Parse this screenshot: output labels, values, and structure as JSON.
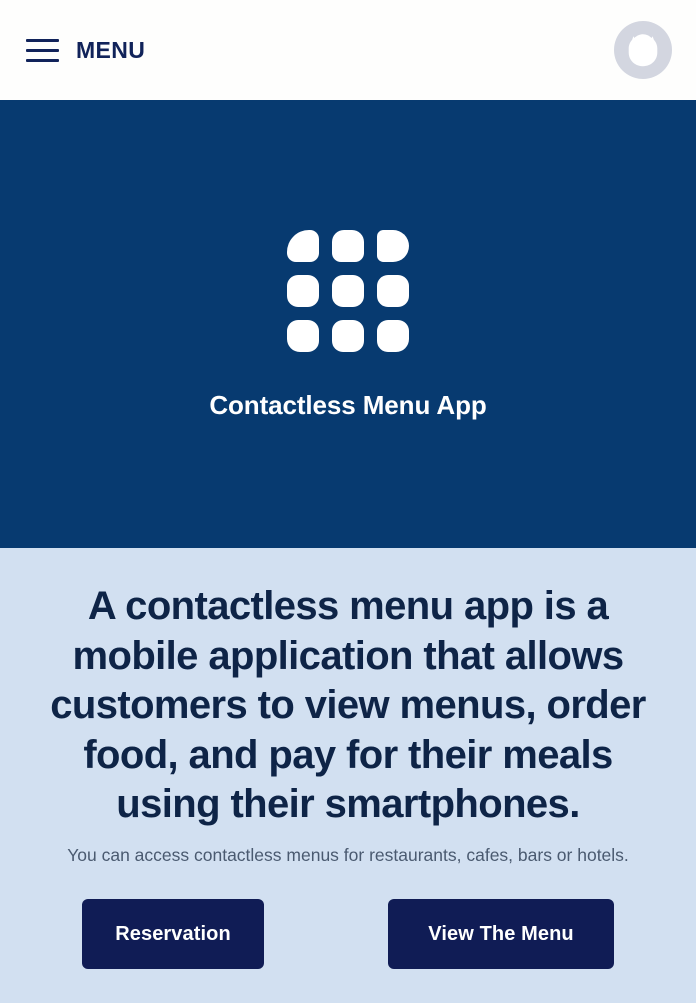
{
  "header": {
    "menu_label": "MENU",
    "hamburger_icon": "hamburger-menu-icon",
    "logo_icon": "brand-crown-logo-icon",
    "background_color": "#fefefd",
    "text_color": "#11235a",
    "logo_background_color": "#d3d6e0"
  },
  "hero": {
    "app_icon": "app-grid-icon",
    "title": "Contactless Menu App",
    "background_color": "#073a70",
    "title_color": "#ffffff",
    "tiles": [
      "tile-top-left",
      "tile-top-center",
      "tile-top-right",
      "tile-middle-left",
      "tile-middle-center",
      "tile-middle-right",
      "tile-bottom-left",
      "tile-bottom-center",
      "tile-bottom-right"
    ]
  },
  "intro": {
    "heading": "A contactless menu app is a mobile application that allows customers to view menus, order food, and pay for their meals using their smartphones.",
    "subtext": "You can access contactless menus for restaurants, cafes, bars or hotels.",
    "background_color": "#d2e0f1",
    "heading_color": "#0e2447",
    "subtext_color": "#4a5a70",
    "buttons": [
      {
        "label": "Reservation",
        "name": "reservation-button"
      },
      {
        "label": "View The Menu",
        "name": "view-the-menu-button"
      }
    ],
    "button_background_color": "#101c55",
    "button_text_color": "#ffffff"
  }
}
